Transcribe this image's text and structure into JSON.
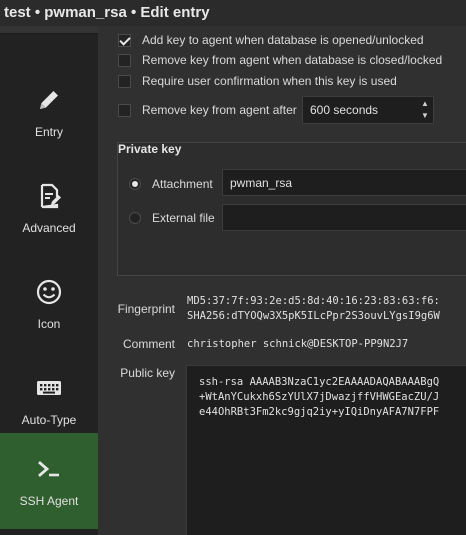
{
  "window": {
    "title": "test • pwman_rsa • Edit entry"
  },
  "sidebar": {
    "items": [
      {
        "label": "Entry",
        "icon": "pencil-icon"
      },
      {
        "label": "Advanced",
        "icon": "document-edit-icon"
      },
      {
        "label": "Icon",
        "icon": "smiley-icon"
      },
      {
        "label": "Auto-Type",
        "icon": "keyboard-icon"
      },
      {
        "label": "SSH Agent",
        "icon": "terminal-prompt-icon",
        "active": true
      }
    ]
  },
  "agent_options": {
    "add_on_open": {
      "label": "Add key to agent when database is opened/unlocked",
      "checked": true
    },
    "remove_on_close": {
      "label": "Remove key from agent when database is closed/locked",
      "checked": false
    },
    "require_confirmation": {
      "label": "Require user confirmation when this key is used",
      "checked": false
    },
    "remove_after": {
      "label": "Remove key from agent after",
      "checked": false,
      "value": "600 seconds"
    }
  },
  "private_key": {
    "title": "Private key",
    "attachment": {
      "label": "Attachment",
      "selected": true,
      "value": "pwman_rsa"
    },
    "external_file": {
      "label": "External file",
      "selected": false,
      "value": ""
    }
  },
  "details": {
    "fingerprint_label": "Fingerprint",
    "fingerprint_md5": "MD5:37:7f:93:2e:d5:8d:40:16:23:83:63:f6:",
    "fingerprint_sha256": "SHA256:dTYOQw3X5pK5ILcPpr2S3ouvLYgsI9g6W",
    "comment_label": "Comment",
    "comment": "christopher schnick@DESKTOP-PP9N2J7",
    "public_key_label": "Public key",
    "public_key_lines": [
      "ssh-rsa AAAAB3NzaC1yc2EAAAADAQABAAABgQ",
      "+WtAnYCukxh6SzYUlX7jDwazjffVHWGEacZU/J",
      "e44OhRBt3Fm2kc9gjq2iy+yIQiDnyAFA7N7FPF"
    ]
  }
}
